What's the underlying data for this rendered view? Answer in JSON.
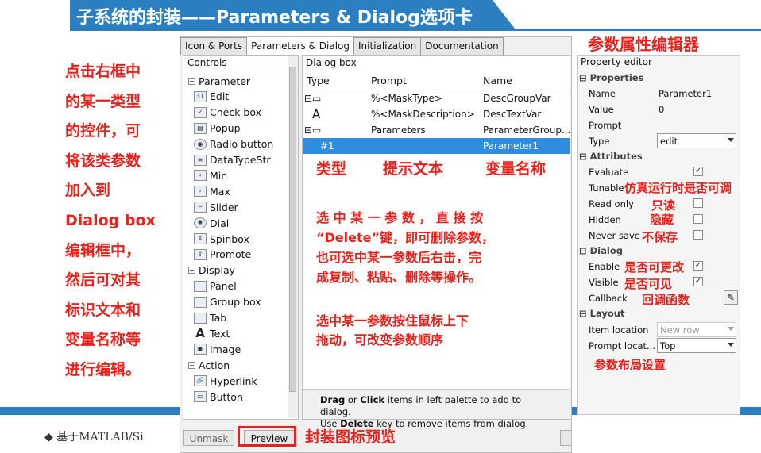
{
  "title": "子系统的封装——Parameters & Dialog选项卡",
  "footer": "◆ 基于MATLAB/Si",
  "left_notes": [
    "点击右框中",
    "的某一类型",
    "的控件，可",
    "将该类参数",
    "加入到",
    "Dialog box",
    "编辑框中，",
    "然后可对其",
    "标识文本和",
    "变量名称等",
    "进行编辑。"
  ],
  "annotations": {
    "property_editor": "参数属性编辑器",
    "type": "类型",
    "prompt_text": "提示文本",
    "var_name": "变量名称",
    "delete_line1": "选 中 某 一 参 数 ， 直 接 按",
    "delete_line2": "“Delete”键，即可删除参数，",
    "delete_line3": "也可选中某一参数后右击，完",
    "delete_line4": "成复制、粘贴、删除等操作。",
    "drag_line1": "选中某一参数按住鼠标上下",
    "drag_line2": "拖动，可改变参数顺序",
    "tunable": "仿真运行时是否可调",
    "readonly": "只读",
    "hidden": "隐藏",
    "never_save": "不保存",
    "enable": "是否可更改",
    "visible": "是否可见",
    "callback": "回调函数",
    "layout": "参数布局设置",
    "preview": "封装图标预览"
  },
  "tabs": [
    "Icon & Ports",
    "Parameters & Dialog",
    "Initialization",
    "Documentation"
  ],
  "palette": {
    "header": "Controls",
    "items": [
      {
        "kind": "group",
        "label": "Parameter"
      },
      {
        "kind": "leaf",
        "label": "Edit",
        "icon": "edit-icon"
      },
      {
        "kind": "leaf",
        "label": "Check box",
        "icon": "checkbox-icon"
      },
      {
        "kind": "leaf",
        "label": "Popup",
        "icon": "popup-icon"
      },
      {
        "kind": "leaf",
        "label": "Radio button",
        "icon": "radio-icon"
      },
      {
        "kind": "leaf",
        "label": "DataTypeStr",
        "icon": "datatype-icon"
      },
      {
        "kind": "leaf",
        "label": "Min",
        "icon": "min-icon"
      },
      {
        "kind": "leaf",
        "label": "Max",
        "icon": "max-icon"
      },
      {
        "kind": "leaf",
        "label": "Slider",
        "icon": "slider-icon"
      },
      {
        "kind": "leaf",
        "label": "Dial",
        "icon": "dial-icon"
      },
      {
        "kind": "leaf",
        "label": "Spinbox",
        "icon": "spinbox-icon"
      },
      {
        "kind": "leaf",
        "label": "Promote",
        "icon": "promote-icon"
      },
      {
        "kind": "group",
        "label": "Display"
      },
      {
        "kind": "leaf",
        "label": "Panel",
        "icon": "panel-icon"
      },
      {
        "kind": "leaf",
        "label": "Group box",
        "icon": "groupbox-icon"
      },
      {
        "kind": "leaf",
        "label": "Tab",
        "icon": "tab-icon"
      },
      {
        "kind": "leaf",
        "label": "Text",
        "icon": "text-icon"
      },
      {
        "kind": "leaf",
        "label": "Image",
        "icon": "image-icon"
      },
      {
        "kind": "group",
        "label": "Action"
      },
      {
        "kind": "leaf",
        "label": "Hyperlink",
        "icon": "hyperlink-icon"
      },
      {
        "kind": "leaf",
        "label": "Button",
        "icon": "button-icon"
      }
    ]
  },
  "dialog_box": {
    "header": "Dialog box",
    "columns": [
      "Type",
      "Prompt",
      "Name"
    ],
    "rows": [
      {
        "type": "⊟▭",
        "prompt": "%<MaskType>",
        "name": "DescGroupVar",
        "selected": false
      },
      {
        "type": "A",
        "prompt": "%<MaskDescription>",
        "name": "DescTextVar",
        "selected": false
      },
      {
        "type": "⊟▭",
        "prompt": "Parameters",
        "name": "ParameterGroup...",
        "selected": false
      },
      {
        "type": "#1",
        "prompt": "",
        "name": "Parameter1",
        "selected": true
      }
    ],
    "footer_line1_pre": "Drag",
    "footer_line1_mid": " or ",
    "footer_line1_b2": "Click",
    "footer_line1_post": " items in left palette to add to dialog.",
    "footer_line2_pre": "Use ",
    "footer_line2_b": "Delete",
    "footer_line2_post": " key to remove items from dialog."
  },
  "property_editor": {
    "header": "Property editor",
    "sections": {
      "properties": "Properties",
      "attributes": "Attributes",
      "dialog": "Dialog",
      "layout": "Layout"
    },
    "name_label": "Name",
    "name_value": "Parameter1",
    "value_label": "Value",
    "value_value": "0",
    "prompt_label": "Prompt",
    "type_label": "Type",
    "type_value": "edit",
    "evaluate": "Evaluate",
    "tunable": "Tunable",
    "read_only": "Read only",
    "hidden": "Hidden",
    "never_save": "Never save",
    "enable": "Enable",
    "visible": "Visible",
    "callback": "Callback",
    "item_location": "Item location",
    "item_location_value": "New row",
    "prompt_location": "Prompt locat...",
    "prompt_location_value": "Top"
  },
  "buttons": {
    "unmask": "Unmask",
    "preview": "Preview"
  }
}
